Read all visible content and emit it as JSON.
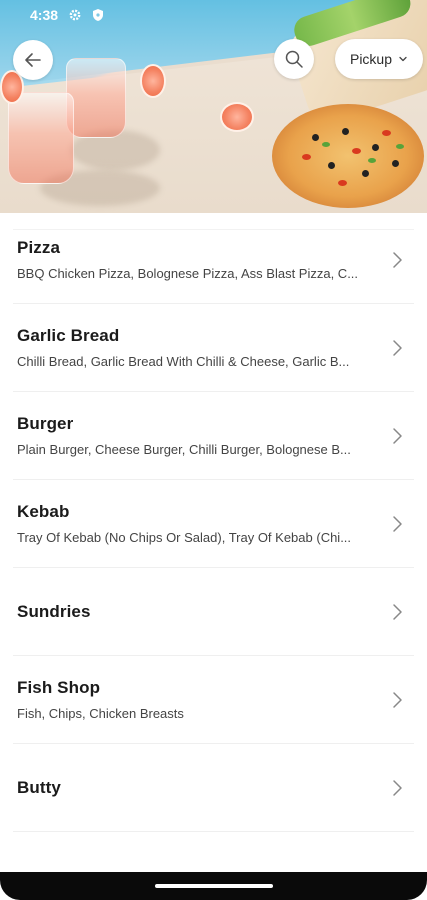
{
  "status_bar": {
    "time": "4:38",
    "icons": [
      "gear-icon",
      "shield-icon"
    ]
  },
  "header": {
    "back_icon": "arrow-left-icon",
    "search_icon": "search-icon",
    "pickup_label": "Pickup",
    "pickup_icon": "chevron-down-icon"
  },
  "categories": [
    {
      "name": "Pizza",
      "items": "BBQ Chicken Pizza, Bolognese Pizza, Ass Blast Pizza, C..."
    },
    {
      "name": "Garlic Bread",
      "items": "Chilli Bread, Garlic Bread With Chilli & Cheese, Garlic B..."
    },
    {
      "name": "Burger",
      "items": "Plain Burger, Cheese Burger, Chilli Burger, Bolognese B..."
    },
    {
      "name": "Kebab",
      "items": "Tray Of Kebab (No Chips Or Salad), Tray Of Kebab (Chi..."
    },
    {
      "name": "Sundries",
      "items": ""
    },
    {
      "name": "Fish Shop",
      "items": "Fish, Chips, Chicken Breasts"
    },
    {
      "name": "Butty",
      "items": ""
    }
  ],
  "colors": {
    "hero_sky": "#64c0e2",
    "hero_table": "#efe4d7",
    "text": "#1b1b1b",
    "subtext": "#444444"
  }
}
